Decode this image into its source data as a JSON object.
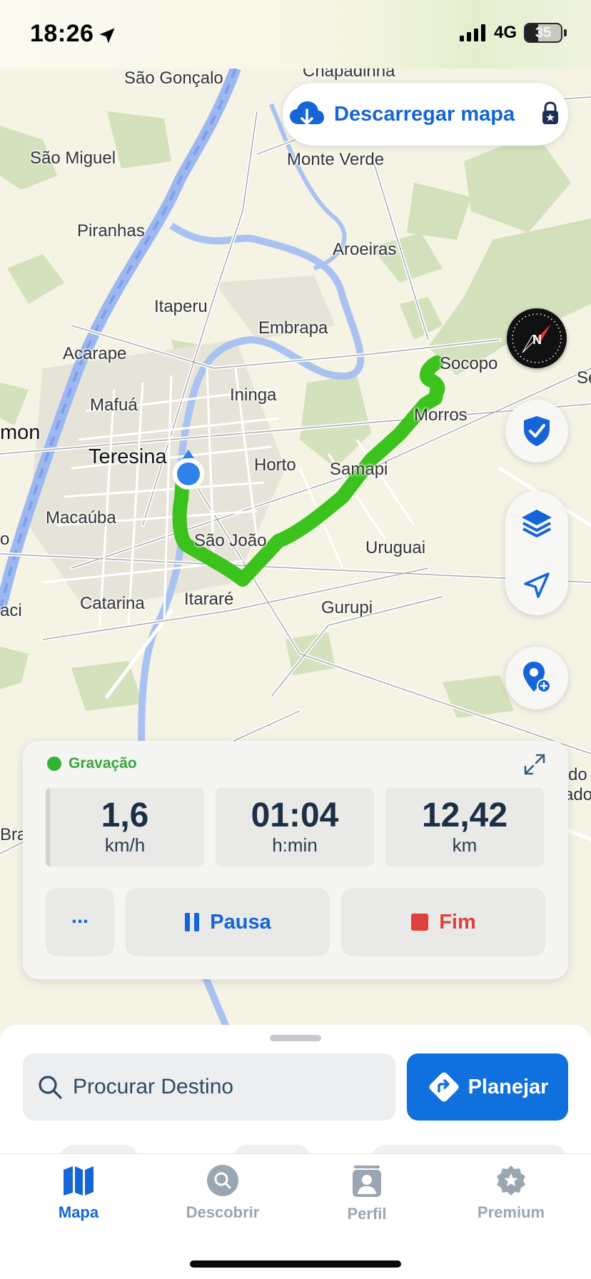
{
  "status_bar": {
    "time": "18:26",
    "network": "4G",
    "battery": "35",
    "battery_level": 0.35
  },
  "map": {
    "download_button": {
      "label": "Descarregar mapa"
    },
    "place_labels": {
      "sao_goncalo": "São Gonçalo",
      "chapadinha": "Chapadinha",
      "sao_miguel": "São Miguel",
      "monte_verde": "Monte Verde",
      "piranhas": "Piranhas",
      "aroeiras": "Aroeiras",
      "itaperu": "Itaperu",
      "embrapa": "Embrapa",
      "acarape": "Acarape",
      "socopo": "Socopo",
      "mafua": "Mafuá",
      "ininga": "Ininga",
      "morros": "Morros",
      "mon": "mon",
      "teresina": "Teresina",
      "horto": "Horto",
      "samapi": "Samapi",
      "macauba": "Macaúba",
      "sao_joao": "São João",
      "uruguai": "Uruguai",
      "catarina": "Catarina",
      "itarare": "Itararé",
      "gurupi": "Gurupi",
      "aci": "aci",
      "bra": "Bra",
      "se": "Se",
      "do1": "do",
      "do2": "ado",
      "o": "o"
    }
  },
  "recording": {
    "status": "Gravação",
    "stats": [
      {
        "value": "1,6",
        "unit": "km/h"
      },
      {
        "value": "01:04",
        "unit": "h:min"
      },
      {
        "value": "12,42",
        "unit": "km"
      }
    ],
    "more_label": "...",
    "pause_label": "Pausa",
    "end_label": "Fim"
  },
  "bottom_sheet": {
    "search_placeholder": "Procurar Destino",
    "plan_label": "Planejar"
  },
  "tabs": [
    {
      "label": "Mapa",
      "icon": "map-icon",
      "active": true
    },
    {
      "label": "Descobrir",
      "icon": "search-icon",
      "active": false
    },
    {
      "label": "Perfil",
      "icon": "profile-icon",
      "active": false
    },
    {
      "label": "Premium",
      "icon": "star-badge-icon",
      "active": false
    }
  ],
  "colors": {
    "accent": "#1565d8",
    "route": "#3cc21c",
    "recording": "#34b233",
    "end": "#e0403d"
  }
}
